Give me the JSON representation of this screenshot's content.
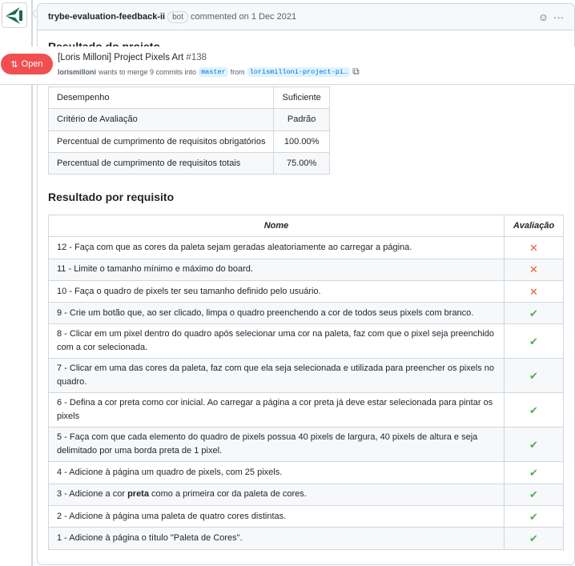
{
  "comment": {
    "author": "trybe-evaluation-feedback-ii",
    "badge": "bot",
    "meta": "commented on 1 Dec 2021",
    "heading1": "Resultado do projeto",
    "heading2": "Resultado por requisito"
  },
  "summary": [
    [
      "Desempenho",
      "Suficiente"
    ],
    [
      "Critério de Avaliação",
      "Padrão"
    ],
    [
      "Percentual de cumprimento de requisitos obrigatórios",
      "100.00%"
    ],
    [
      "Percentual de cumprimento de requisitos totais",
      "75.00%"
    ]
  ],
  "requirements": {
    "headers": [
      "Nome",
      "Avaliação"
    ],
    "rows": [
      {
        "name": "12 - Faça com que as cores da paleta sejam geradas aleatoriamente ao carregar a página.",
        "status": "fail"
      },
      {
        "name": "11 - Limite o tamanho mínimo e máximo do board.",
        "status": "fail"
      },
      {
        "name": "10 - Faça o quadro de pixels ter seu tamanho definido pelo usuário.",
        "status": "fail"
      },
      {
        "name": "9 - Crie um botão que, ao ser clicado, limpa o quadro preenchendo a cor de todos seus pixels com branco.",
        "status": "pass"
      },
      {
        "name": "8 - Clicar em um pixel dentro do quadro após selecionar uma cor na paleta, faz com que o pixel seja preenchido com a cor selecionada.",
        "status": "pass"
      },
      {
        "name": "7 - Clicar em uma das cores da paleta, faz com que ela seja selecionada e utilizada para preencher os pixels no quadro.",
        "status": "pass"
      },
      {
        "name": "6 - Defina a cor preta como cor inicial. Ao carregar a página a cor preta já deve estar selecionada para pintar os pixels",
        "status": "pass"
      },
      {
        "name": "5 - Faça com que cada elemento do quadro de pixels possua 40 pixels de largura, 40 pixels de altura e seja delimitado por uma borda preta de 1 pixel.",
        "status": "pass"
      },
      {
        "name": "4 - Adicione à página um quadro de pixels, com 25 pixels.",
        "status": "pass"
      },
      {
        "name_pre": "3 - Adicione a cor ",
        "name_bold": "preta",
        "name_post": " como a primeira cor da paleta de cores.",
        "status": "pass"
      },
      {
        "name": "2 - Adicione à página uma paleta de quatro cores distintas.",
        "status": "pass"
      },
      {
        "name": "1 - Adicione à página o título \"Paleta de Cores\".",
        "status": "pass"
      }
    ]
  },
  "icons": {
    "fail": "✕",
    "pass": "✔"
  },
  "pr": {
    "state": "Open",
    "title": "[Loris Milloni] Project Pixels Art",
    "number": "#138",
    "author": "lorismilloni",
    "action": "wants to merge 9 commits into",
    "base": "master",
    "from": "from",
    "head": "lorismilloni-project-pi…"
  },
  "colors": {
    "open": "#f14f4f",
    "fail": "#e8603c",
    "pass": "#4caf50"
  }
}
